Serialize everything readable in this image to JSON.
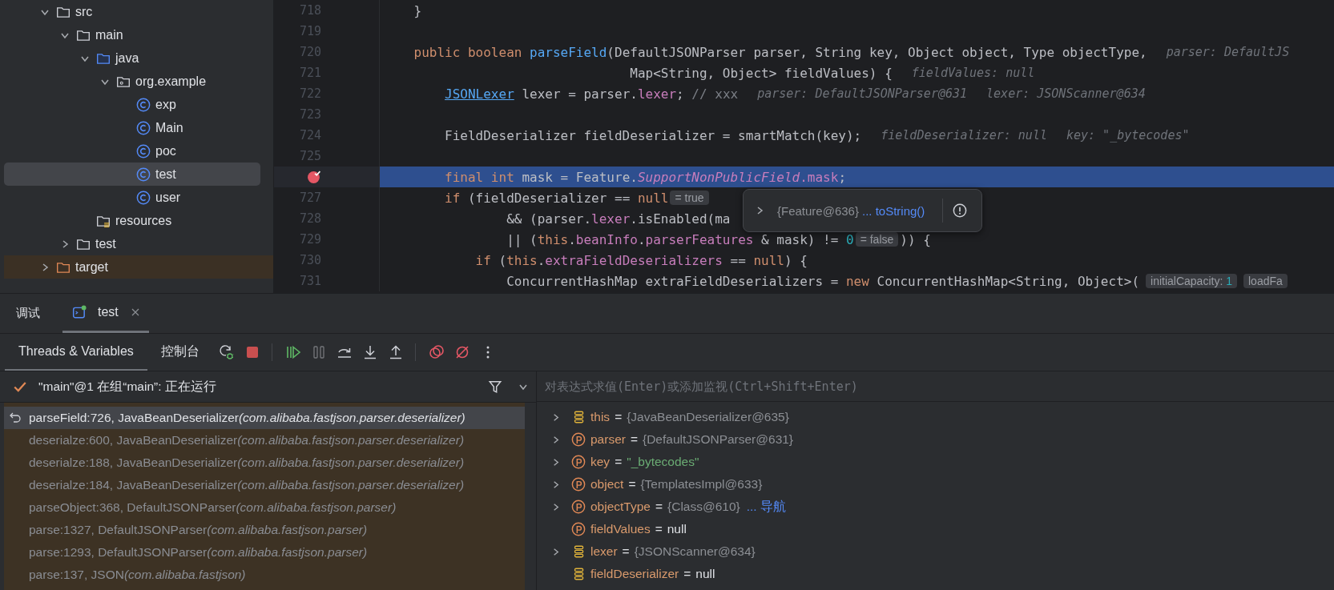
{
  "project": {
    "items": [
      {
        "label": "src",
        "kind": "folder",
        "expanded": true,
        "selected": false,
        "children": [
          {
            "label": "main",
            "kind": "folder",
            "expanded": true,
            "selected": false,
            "children": [
              {
                "label": "java",
                "kind": "source-folder",
                "expanded": true,
                "selected": false,
                "children": [
                  {
                    "label": "org.example",
                    "kind": "package",
                    "expanded": true,
                    "selected": false,
                    "children": [
                      {
                        "label": "exp",
                        "kind": "class",
                        "selected": false
                      },
                      {
                        "label": "Main",
                        "kind": "class",
                        "selected": false
                      },
                      {
                        "label": "poc",
                        "kind": "class",
                        "selected": false
                      },
                      {
                        "label": "test",
                        "kind": "class",
                        "selected": true
                      },
                      {
                        "label": "user",
                        "kind": "class",
                        "selected": false
                      }
                    ]
                  }
                ]
              },
              {
                "label": "resources",
                "kind": "resource-folder",
                "selected": false
              }
            ]
          },
          {
            "label": "test",
            "kind": "folder",
            "expanded": false,
            "selected": false
          }
        ]
      },
      {
        "label": "target",
        "kind": "excluded-folder",
        "expanded": false,
        "selected": false
      }
    ]
  },
  "editor": {
    "lines": [
      {
        "number": "718",
        "breakpoint": false,
        "selected": false,
        "parts": [
          {
            "kind": "code",
            "tokens": [
              {
                "kind": "plain",
                "text": "    }"
              }
            ]
          }
        ]
      },
      {
        "number": "719",
        "breakpoint": false,
        "selected": false
      },
      {
        "number": "720",
        "breakpoint": false,
        "selected": false,
        "parts": [
          {
            "kind": "code",
            "tokens": [
              {
                "kind": "keyword",
                "text": "    public boolean "
              },
              {
                "kind": "method",
                "text": "parseField"
              },
              {
                "kind": "plain",
                "text": "(DefaultJSONParser parser, String key, Object object, Type objectType,"
              }
            ]
          },
          {
            "kind": "hint",
            "text": "parser: DefaultJS"
          }
        ]
      },
      {
        "number": "721",
        "breakpoint": false,
        "selected": false,
        "parts": [
          {
            "kind": "code",
            "tokens": [
              {
                "kind": "plain",
                "text": "                                Map<String, Object> fieldValues) {"
              }
            ]
          },
          {
            "kind": "hint",
            "text": "fieldValues: null"
          }
        ]
      },
      {
        "number": "722",
        "breakpoint": false,
        "selected": false,
        "parts": [
          {
            "kind": "code",
            "tokens": [
              {
                "kind": "link",
                "text": "        JSONLexer"
              },
              {
                "kind": "plain",
                "text": " lexer = parser."
              },
              {
                "kind": "field",
                "text": "lexer"
              },
              {
                "kind": "plain",
                "text": "; "
              },
              {
                "kind": "comment",
                "text": "// xxx"
              }
            ]
          },
          {
            "kind": "hint",
            "text": "parser: DefaultJSONParser@631"
          },
          {
            "kind": "hint",
            "text": "lexer: JSONScanner@634"
          }
        ]
      },
      {
        "number": "723",
        "breakpoint": false,
        "selected": false
      },
      {
        "number": "724",
        "breakpoint": false,
        "selected": false,
        "parts": [
          {
            "kind": "code",
            "tokens": [
              {
                "kind": "plain",
                "text": "        FieldDeserializer fieldDeserializer = smartMatch(key);"
              }
            ]
          },
          {
            "kind": "hint",
            "text": "fieldDeserializer: null"
          },
          {
            "kind": "hint",
            "text": "key: \"_bytecodes\""
          }
        ]
      },
      {
        "number": "725",
        "breakpoint": false,
        "selected": false
      },
      {
        "breakpoint": true,
        "selected": true,
        "parts": [
          {
            "kind": "code",
            "tokens": [
              {
                "kind": "keyword",
                "text": "        final int"
              },
              {
                "kind": "plain",
                "text": " mask = Feature."
              },
              {
                "kind": "static",
                "text": "SupportNonPublicField"
              },
              {
                "kind": "field",
                "text": ".mask"
              },
              {
                "kind": "plain",
                "text": ";"
              }
            ]
          }
        ]
      },
      {
        "number": "727",
        "breakpoint": false,
        "selected": false,
        "parts": [
          {
            "kind": "code",
            "tokens": [
              {
                "kind": "keyword",
                "text": "        if"
              },
              {
                "kind": "plain",
                "text": " (fieldDeserializer == "
              },
              {
                "kind": "keyword",
                "text": "null"
              }
            ]
          },
          {
            "kind": "badge",
            "text": "= true"
          }
        ]
      },
      {
        "number": "728",
        "breakpoint": false,
        "selected": false,
        "parts": [
          {
            "kind": "code",
            "tokens": [
              {
                "kind": "plain",
                "text": "                && (parser."
              },
              {
                "kind": "field",
                "text": "lexer"
              },
              {
                "kind": "plain",
                "text": ".isEnabled(ma"
              }
            ]
          }
        ]
      },
      {
        "number": "729",
        "breakpoint": false,
        "selected": false,
        "parts": [
          {
            "kind": "code",
            "tokens": [
              {
                "kind": "plain",
                "text": "                || ("
              },
              {
                "kind": "keyword",
                "text": "this"
              },
              {
                "kind": "plain",
                "text": "."
              },
              {
                "kind": "field",
                "text": "beanInfo"
              },
              {
                "kind": "plain",
                "text": "."
              },
              {
                "kind": "field",
                "text": "parserFeatures"
              },
              {
                "kind": "plain",
                "text": " & mask) != "
              },
              {
                "kind": "number",
                "text": "0"
              }
            ]
          },
          {
            "kind": "badge",
            "text": "= false"
          },
          {
            "kind": "code",
            "tokens": [
              {
                "kind": "plain",
                "text": ")) {"
              }
            ]
          }
        ]
      },
      {
        "number": "730",
        "breakpoint": false,
        "selected": false,
        "parts": [
          {
            "kind": "code",
            "tokens": [
              {
                "kind": "keyword",
                "text": "            if"
              },
              {
                "kind": "plain",
                "text": " ("
              },
              {
                "kind": "keyword",
                "text": "this"
              },
              {
                "kind": "plain",
                "text": "."
              },
              {
                "kind": "field",
                "text": "extraFieldDeserializers"
              },
              {
                "kind": "plain",
                "text": " == "
              },
              {
                "kind": "keyword",
                "text": "null"
              },
              {
                "kind": "plain",
                "text": ") {"
              }
            ]
          }
        ]
      },
      {
        "number": "731",
        "breakpoint": false,
        "selected": false,
        "parts": [
          {
            "kind": "code",
            "tokens": [
              {
                "kind": "plain",
                "text": "                ConcurrentHashMap extraFieldDeserializers = "
              },
              {
                "kind": "keyword",
                "text": "new"
              },
              {
                "kind": "plain",
                "text": " ConcurrentHashMap<String, Object>("
              }
            ]
          },
          {
            "kind": "param",
            "name": "initialCapacity:",
            "value": "1"
          },
          {
            "kind": "param",
            "name": "loadFa"
          }
        ]
      }
    ],
    "popup": {
      "value": "{Feature@636}",
      "link": "... toString()"
    }
  },
  "debug": {
    "title": "调试",
    "tabs": [
      {
        "label": "test",
        "selected": true
      }
    ],
    "subtabs": [
      {
        "label": "Threads & Variables",
        "selected": true
      },
      {
        "label": "控制台",
        "selected": false
      }
    ],
    "actions": [
      {
        "kind": "rerun",
        "disabled": false
      },
      {
        "kind": "stop",
        "disabled": false
      },
      {
        "kind": "sep"
      },
      {
        "kind": "resume",
        "disabled": false
      },
      {
        "kind": "pause",
        "disabled": true
      },
      {
        "kind": "step-over",
        "disabled": false
      },
      {
        "kind": "step-into",
        "disabled": false
      },
      {
        "kind": "step-out",
        "disabled": false
      },
      {
        "kind": "sep"
      },
      {
        "kind": "breakpoints",
        "disabled": false
      },
      {
        "kind": "mute",
        "disabled": false
      },
      {
        "kind": "more",
        "disabled": false
      }
    ],
    "thread": "\"main\"@1 在组“main”: 正在运行",
    "frames": [
      {
        "method": "parseField:726, JavaBeanDeserializer",
        "package": "(com.alibaba.fastjson.parser.deserializer)",
        "selected": true
      },
      {
        "method": "deserialze:600, JavaBeanDeserializer",
        "package": "(com.alibaba.fastjson.parser.deserializer)",
        "selected": false
      },
      {
        "method": "deserialze:188, JavaBeanDeserializer",
        "package": "(com.alibaba.fastjson.parser.deserializer)",
        "selected": false
      },
      {
        "method": "deserialze:184, JavaBeanDeserializer",
        "package": "(com.alibaba.fastjson.parser.deserializer)",
        "selected": false
      },
      {
        "method": "parseObject:368, DefaultJSONParser",
        "package": "(com.alibaba.fastjson.parser)",
        "selected": false
      },
      {
        "method": "parse:1327, DefaultJSONParser",
        "package": "(com.alibaba.fastjson.parser)",
        "selected": false
      },
      {
        "method": "parse:1293, DefaultJSONParser",
        "package": "(com.alibaba.fastjson.parser)",
        "selected": false
      },
      {
        "method": "parse:137, JSON",
        "package": "(com.alibaba.fastjson)",
        "selected": false
      }
    ],
    "evaluate": {
      "placeholder": "对表达式求值(Enter)或添加监视(Ctrl+Shift+Enter)"
    },
    "variables": [
      {
        "name": "this",
        "equals": "=",
        "value": "{JavaBeanDeserializer@635}",
        "kind": "field",
        "color": "#8c8f94",
        "expandable": true
      },
      {
        "name": "parser",
        "equals": "=",
        "value": "{DefaultJSONParser@631}",
        "kind": "param",
        "color": "#8c8f94",
        "expandable": true
      },
      {
        "name": "key",
        "equals": "=",
        "value": "\"_bytecodes\"",
        "kind": "param",
        "color": "#6aab73",
        "expandable": true
      },
      {
        "name": "object",
        "equals": "=",
        "value": "{TemplatesImpl@633}",
        "kind": "param",
        "color": "#8c8f94",
        "expandable": true
      },
      {
        "name": "objectType",
        "equals": "=",
        "value": "{Class@610}",
        "kind": "param",
        "color": "#8c8f94",
        "expandable": true,
        "link": "... 导航"
      },
      {
        "name": "fieldValues",
        "equals": "=",
        "value": "null",
        "kind": "param",
        "color": "#dfe1e5",
        "expandable": false
      },
      {
        "name": "lexer",
        "equals": "=",
        "value": "{JSONScanner@634}",
        "kind": "field",
        "color": "#8c8f94",
        "expandable": true
      },
      {
        "name": "fieldDeserializer",
        "equals": "=",
        "value": "null",
        "kind": "field",
        "color": "#dfe1e5",
        "expandable": false
      }
    ]
  }
}
